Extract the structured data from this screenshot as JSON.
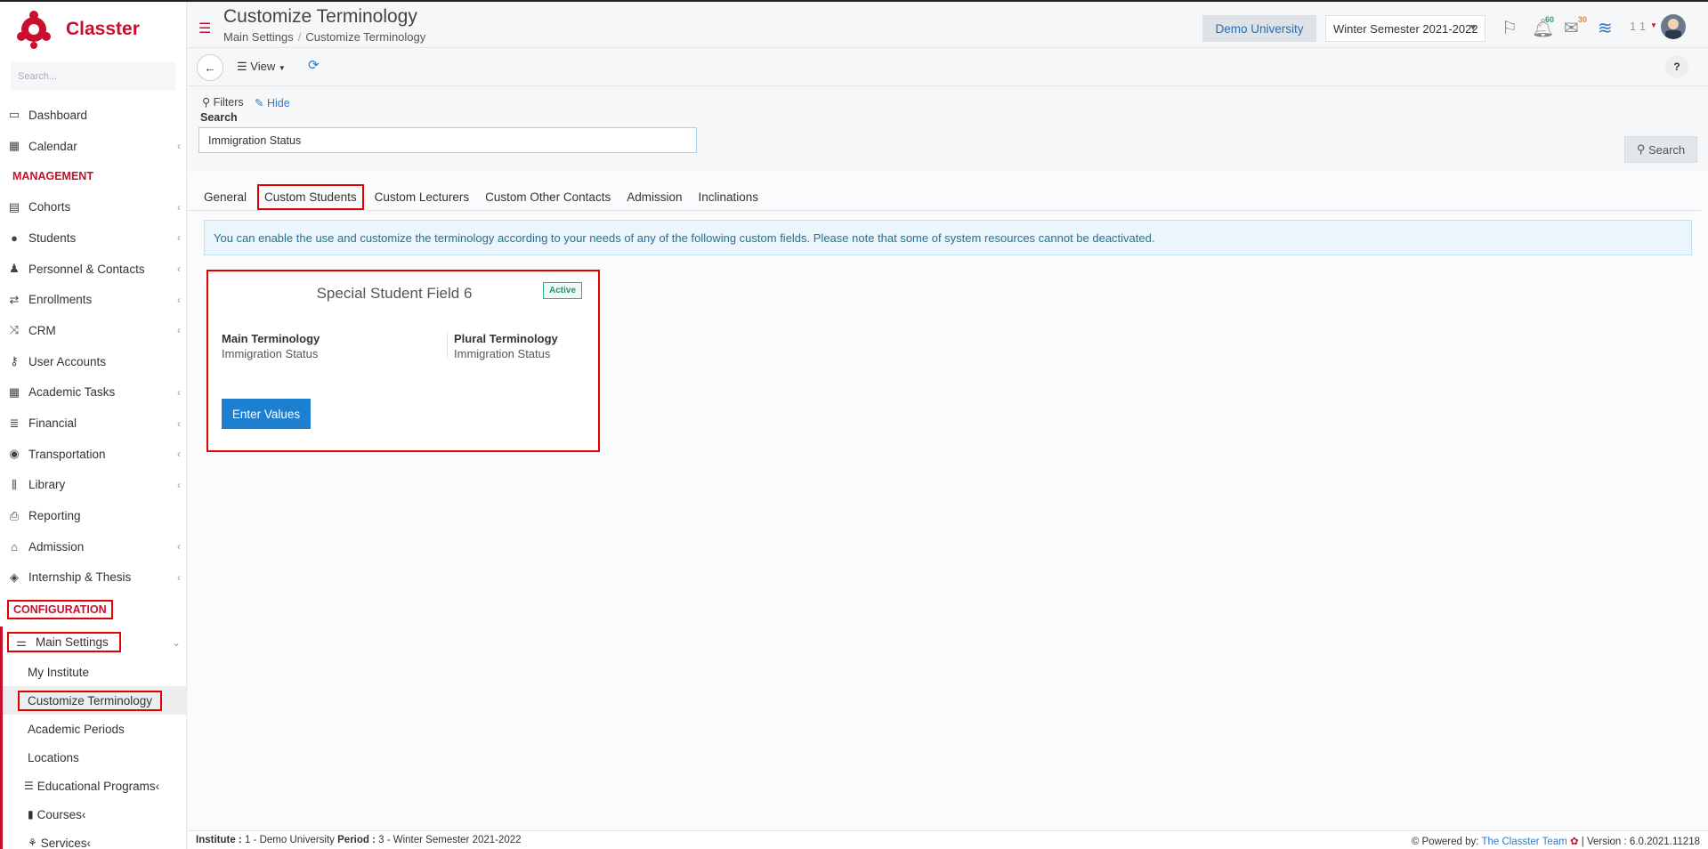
{
  "brand": {
    "name": "Classter"
  },
  "sidebar": {
    "search_placeholder": "Search...",
    "top_items": [
      {
        "label": "Dashboard",
        "icon": "laptop-icon"
      },
      {
        "label": "Calendar",
        "icon": "calendar-icon"
      }
    ],
    "management_title": "MANAGEMENT",
    "management_items": [
      {
        "label": "Cohorts"
      },
      {
        "label": "Students"
      },
      {
        "label": "Personnel & Contacts"
      },
      {
        "label": "Enrollments"
      },
      {
        "label": "CRM"
      },
      {
        "label": "User Accounts"
      },
      {
        "label": "Academic Tasks"
      },
      {
        "label": "Financial"
      },
      {
        "label": "Transportation"
      },
      {
        "label": "Library"
      },
      {
        "label": "Reporting"
      },
      {
        "label": "Admission"
      },
      {
        "label": "Internship & Thesis"
      }
    ],
    "configuration_title": "CONFIGURATION",
    "main_settings_label": "Main Settings",
    "sub_items": [
      {
        "label": "My Institute"
      },
      {
        "label": "Customize Terminology"
      },
      {
        "label": "Academic Periods"
      },
      {
        "label": "Locations"
      },
      {
        "label": "Educational Programs"
      },
      {
        "label": "Courses"
      },
      {
        "label": "Services"
      }
    ]
  },
  "header": {
    "title": "Customize Terminology",
    "breadcrumb": [
      "Main Settings",
      "Customize Terminology"
    ],
    "university": "Demo University",
    "semester": "Winter Semester 2021-2022",
    "notifications_count": "60",
    "messages_count": "30",
    "user_count": "1 1"
  },
  "toolbar": {
    "view_label": "View",
    "help_label": "?"
  },
  "filters": {
    "filters_label": "Filters",
    "hide_label": "Hide",
    "search_label": "Search",
    "search_value": "Immigration Status",
    "search_button": "Search"
  },
  "tabs": [
    "General",
    "Custom Students",
    "Custom Lecturers",
    "Custom Other Contacts",
    "Admission",
    "Inclinations"
  ],
  "info_text": "You can enable the use and customize the terminology according to your needs of any of the following custom fields. Please note that some of system resources cannot be deactivated.",
  "card": {
    "title": "Special Student Field 6",
    "status": "Active",
    "main_label": "Main Terminology",
    "main_value": "Immigration Status",
    "plural_label": "Plural Terminology",
    "plural_value": "Immigration Status",
    "button": "Enter Values"
  },
  "footer": {
    "institute_label": "Institute :",
    "institute_value": "1 - Demo University",
    "period_label": "Period :",
    "period_value": "3 - Winter Semester 2021-2022",
    "powered_by": "Powered by:",
    "team": "The Classter Team",
    "version": "| Version : 6.0.2021.11218"
  }
}
